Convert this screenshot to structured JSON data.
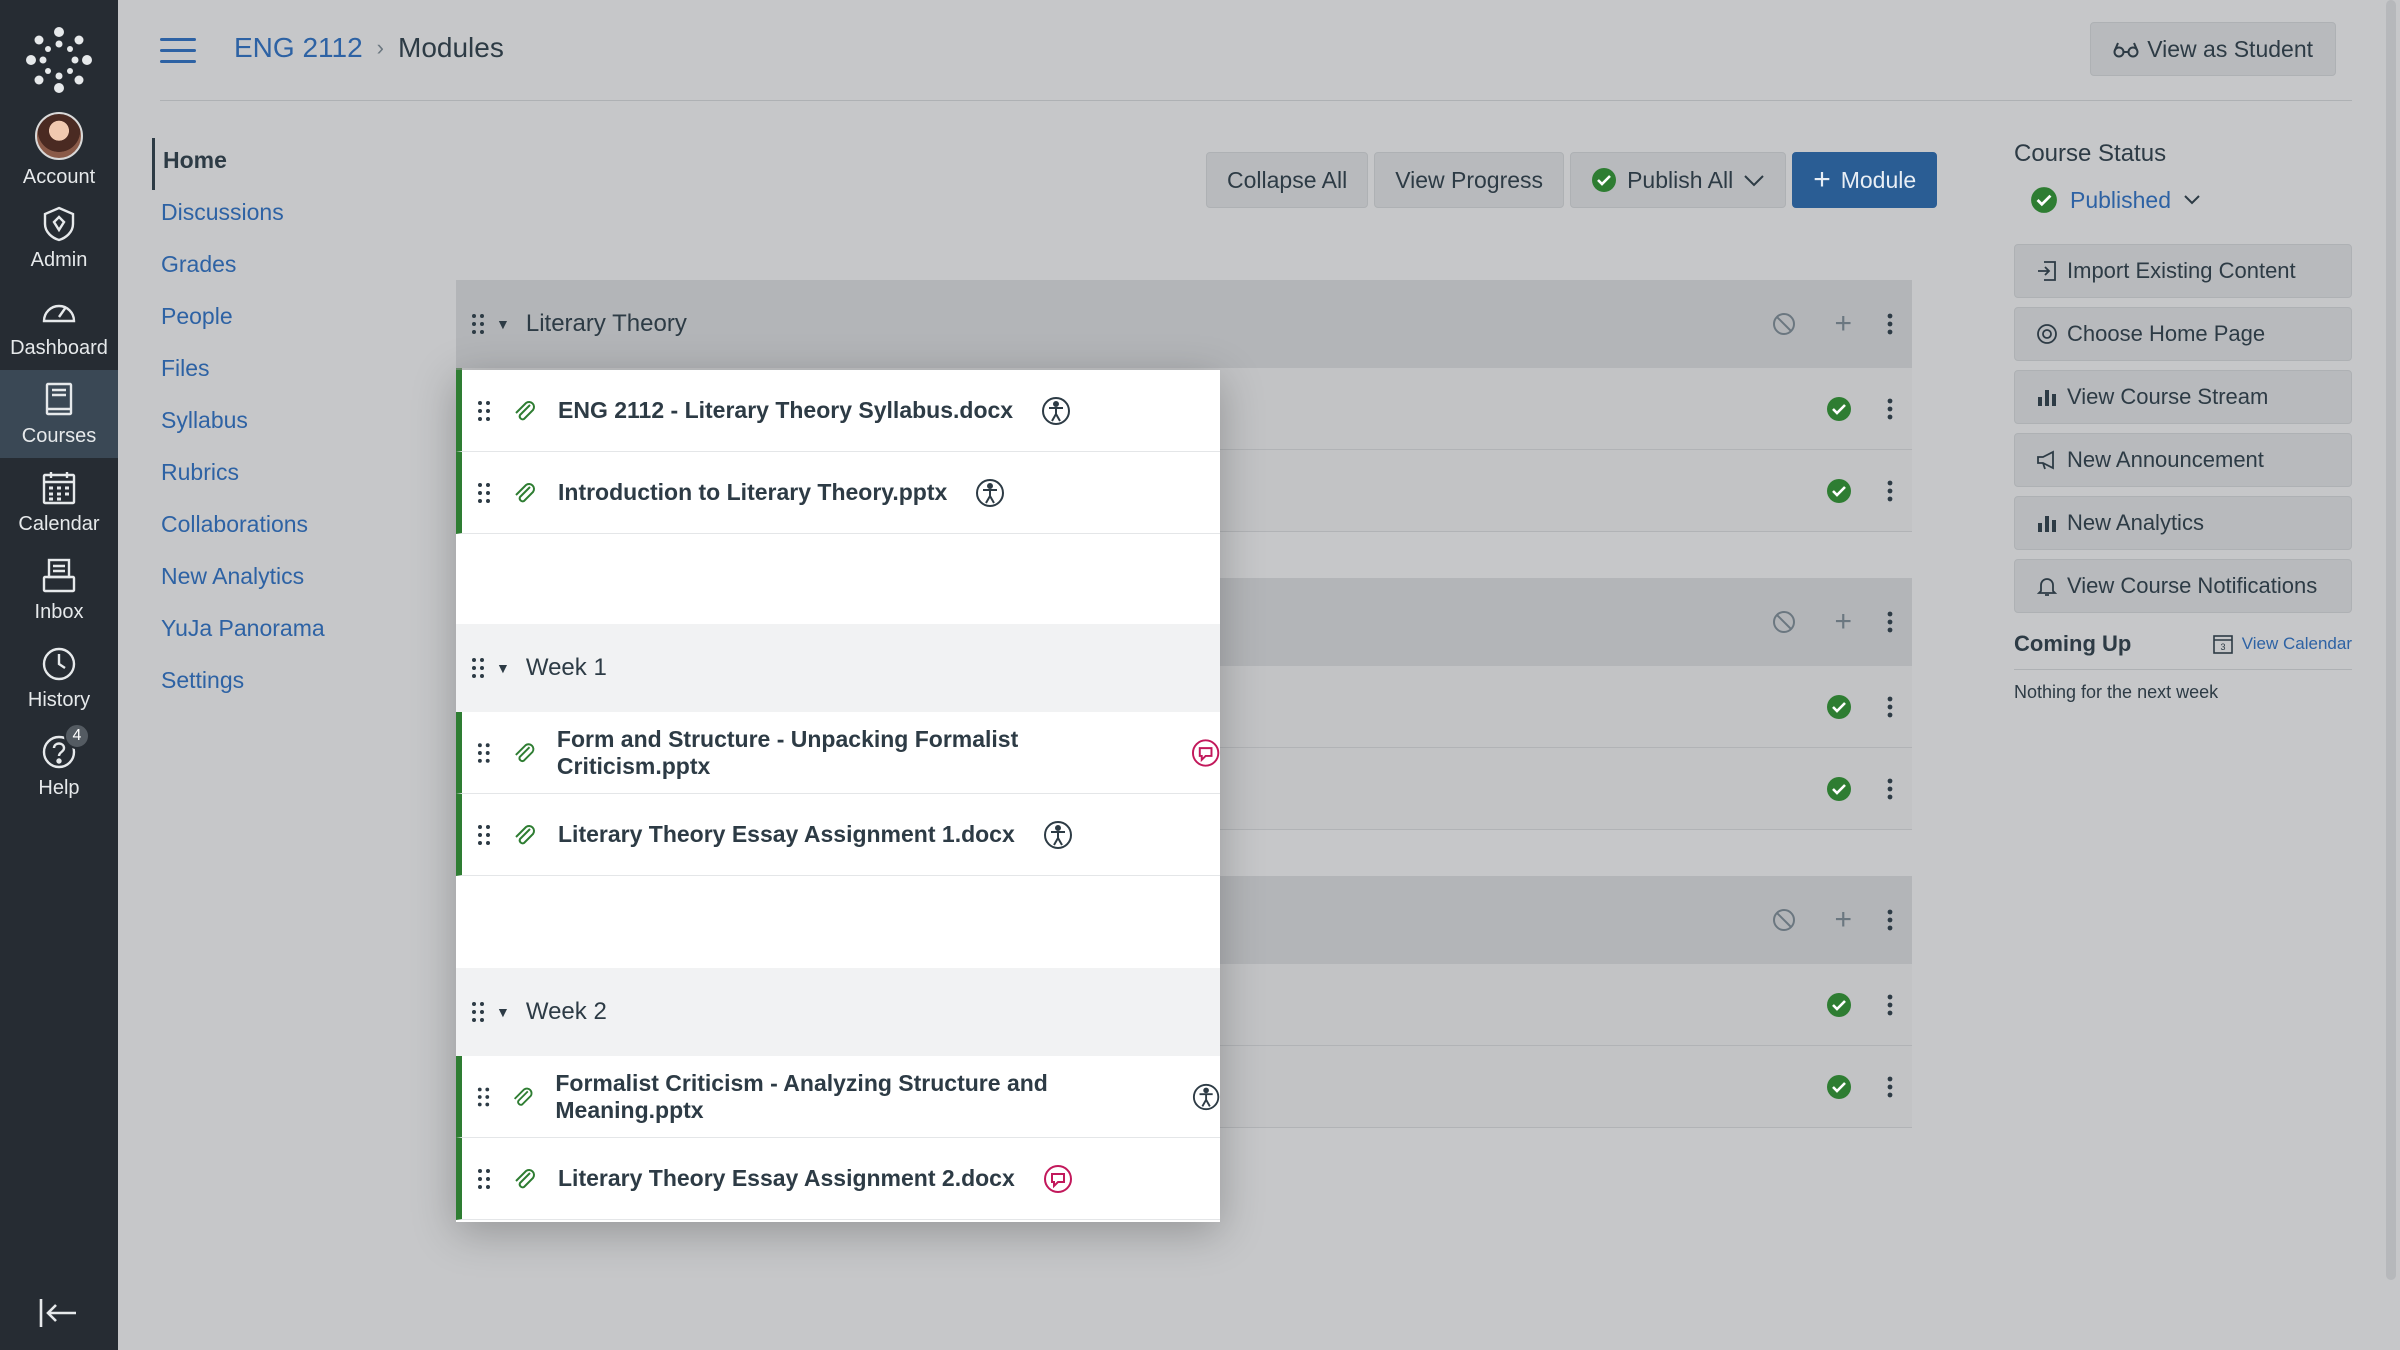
{
  "global_nav": {
    "items": [
      {
        "label": "Account",
        "icon": "account-avatar"
      },
      {
        "label": "Admin",
        "icon": "admin-shield-icon"
      },
      {
        "label": "Dashboard",
        "icon": "dashboard-gauge-icon"
      },
      {
        "label": "Courses",
        "icon": "courses-book-icon"
      },
      {
        "label": "Calendar",
        "icon": "calendar-icon"
      },
      {
        "label": "Inbox",
        "icon": "inbox-icon"
      },
      {
        "label": "History",
        "icon": "history-clock-icon"
      },
      {
        "label": "Help",
        "icon": "help-question-icon"
      }
    ],
    "help_badge": "4"
  },
  "header": {
    "breadcrumb_course": "ENG 2112",
    "breadcrumb_page": "Modules",
    "view_as_student": "View as Student"
  },
  "course_nav": {
    "items": [
      "Home",
      "Discussions",
      "Grades",
      "People",
      "Files",
      "Syllabus",
      "Rubrics",
      "Collaborations",
      "New Analytics",
      "YuJa Panorama",
      "Settings"
    ]
  },
  "toolbar": {
    "collapse_all": "Collapse All",
    "view_progress": "View Progress",
    "publish_all": "Publish All",
    "add_module": "Module"
  },
  "modules": [
    {
      "title": "Literary Theory",
      "items": [
        {
          "title": "ENG 2112 - Literary Theory Syllabus.docx",
          "a11y": "good"
        },
        {
          "title": "Introduction to Literary Theory.pptx",
          "a11y": "good"
        }
      ]
    },
    {
      "title": "Week 1",
      "items": [
        {
          "title": "Form and Structure - Unpacking Formalist Criticism.pptx",
          "a11y": "issue"
        },
        {
          "title": "Literary Theory Essay Assignment 1.docx",
          "a11y": "good"
        }
      ]
    },
    {
      "title": "Week 2",
      "items": [
        {
          "title": "Formalist Criticism - Analyzing Structure and Meaning.pptx",
          "a11y": "good"
        },
        {
          "title": "Literary Theory Essay Assignment 2.docx",
          "a11y": "issue"
        }
      ]
    }
  ],
  "sidebar": {
    "course_status_title": "Course Status",
    "status": "Published",
    "buttons": [
      "Import Existing Content",
      "Choose Home Page",
      "View Course Stream",
      "New Announcement",
      "New Analytics",
      "View Course Notifications"
    ],
    "coming_up_title": "Coming Up",
    "view_calendar": "View Calendar",
    "calendar_day": "3",
    "nothing_next_week": "Nothing for the next week"
  },
  "colors": {
    "nav_bg": "#262c33",
    "link": "#2d62a4",
    "primary_button": "#2a5d94",
    "published_green": "#2e7d32",
    "a11y_issue": "#c2185b"
  }
}
